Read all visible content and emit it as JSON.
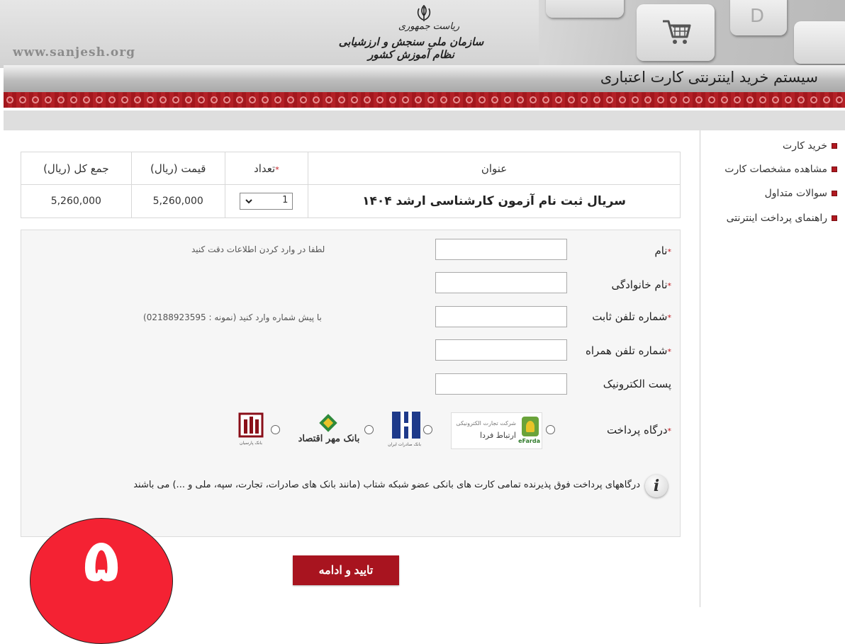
{
  "header": {
    "site_url": "www.sanjesh.org",
    "org_subtitle": "ریاست جمهوری",
    "org_name": "سازمان ملی سنجش و ارزشیابی نظام آموزش کشور",
    "system_title": "سیستم خرید اینترنتی کارت اعتباری",
    "key_letter": "D"
  },
  "menu": {
    "items": [
      {
        "label": "خرید کارت"
      },
      {
        "label": "مشاهده مشخصات کارت"
      },
      {
        "label": "سوالات متداول"
      },
      {
        "label": "راهنمای پرداخت اینترنتی"
      }
    ]
  },
  "table": {
    "headers": {
      "title": "عنوان",
      "quantity": "تعداد",
      "price": "قیمت (ریال)",
      "total": "جمع کل (ریال)"
    },
    "row": {
      "title": "سریال ثبت نام آزمون کارشناسی ارشد ۱۴۰۴",
      "quantity": "1",
      "price": "5,260,000",
      "total": "5,260,000"
    },
    "required_mark": "*"
  },
  "form": {
    "required_mark": "*",
    "fields": {
      "first_name": {
        "label": "نام",
        "hint": "لطفا در وارد کردن اطلاعات دقت کنید",
        "value": ""
      },
      "last_name": {
        "label": "نام خانوادگی",
        "value": ""
      },
      "landline": {
        "label": "شماره تلفن ثابت",
        "hint": "با پیش شماره وارد کنید (نمونه : 02188923595)",
        "value": ""
      },
      "mobile": {
        "label": "شماره تلفن همراه",
        "value": ""
      },
      "email": {
        "label": "پست الکترونیک",
        "value": ""
      }
    },
    "gateway": {
      "label": "درگاه پرداخت",
      "options": [
        {
          "name": "efarda",
          "logo_text_1": "شرکت تجارت الکترونیکی",
          "logo_text_2": "ارتباط فردا",
          "logo_text_3": "eFarda",
          "selected": false
        },
        {
          "name": "bank-saderat",
          "logo_text": "بانک صادرات ایران",
          "selected": false
        },
        {
          "name": "bank-mehr-eqtesad",
          "logo_text": "بانک مهر اقتصاد",
          "selected": false
        },
        {
          "name": "bank-parsian",
          "logo_text": "بانک پارسیان",
          "selected": false
        }
      ]
    },
    "info_icon_letter": "i",
    "info_text": "درگاههای پرداخت فوق پذیرنده تمامی کارت های بانکی عضو شبکه شتاب (مانند بانک های صادرات، تجارت، سپه، ملی و ...) می باشند"
  },
  "submit_label": "تایید و ادامه",
  "step_badge": "۵",
  "colors": {
    "accent": "#a8141f",
    "badge": "#f42233",
    "pattern": "#a3171d"
  }
}
